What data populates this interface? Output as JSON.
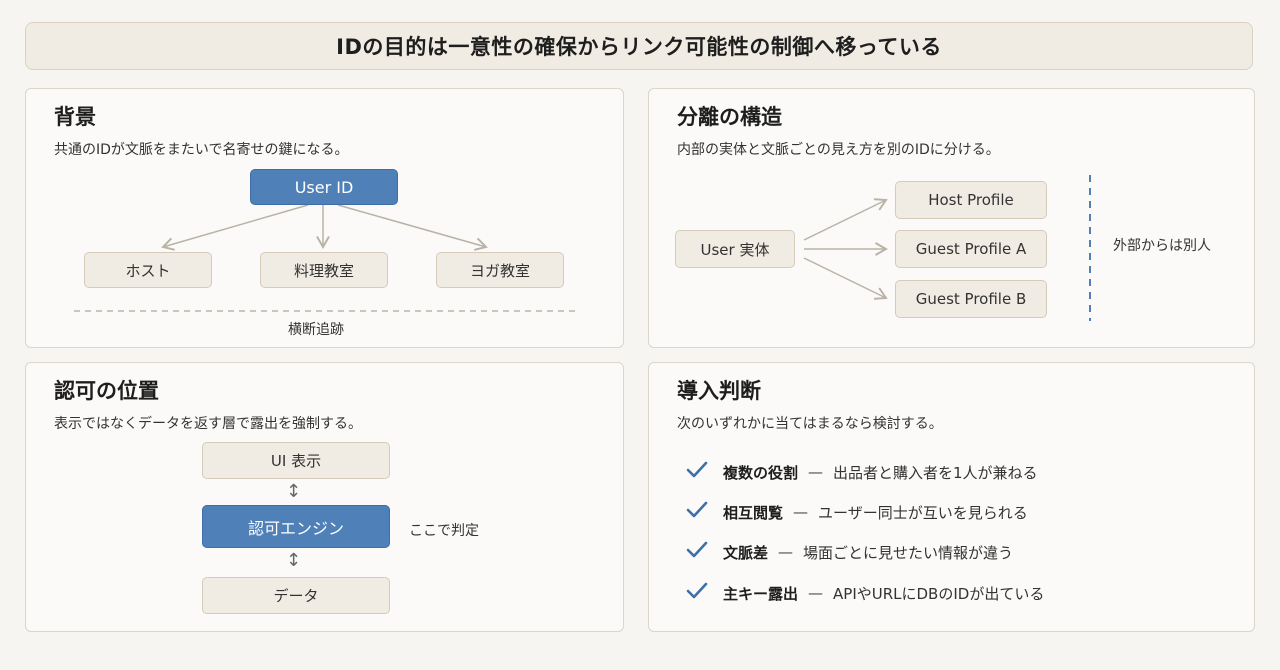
{
  "title": "IDの目的は一意性の確保からリンク可能性の制御へ移っている",
  "panels": {
    "background": {
      "heading": "背景",
      "subtitle": "共通のIDが文脈をまたいで名寄せの鍵になる。",
      "root": "User ID",
      "children": [
        "ホスト",
        "料理教室",
        "ヨガ教室"
      ],
      "footer": "横断追跡"
    },
    "separation": {
      "heading": "分離の構造",
      "subtitle": "内部の実体と文脈ごとの見え方を別のIDに分ける。",
      "source": "User 実体",
      "profiles": [
        "Host Profile",
        "Guest Profile A",
        "Guest Profile B"
      ],
      "side_note": "外部からは別人"
    },
    "authz": {
      "heading": "認可の位置",
      "subtitle": "表示ではなくデータを返す層で露出を強制する。",
      "layers": [
        "UI 表示",
        "認可エンジン",
        "データ"
      ],
      "note": "ここで判定",
      "arrow_glyph": "↕"
    },
    "adoption": {
      "heading": "導入判断",
      "subtitle": "次のいずれかに当てはまるなら検討する。",
      "dash": "—",
      "items": [
        {
          "key": "複数の役割",
          "desc": "出品者と購入者を1人が兼ねる"
        },
        {
          "key": "相互閲覧",
          "desc": "ユーザー同士が互いを見られる"
        },
        {
          "key": "文脈差",
          "desc": "場面ごとに見せたい情報が違う"
        },
        {
          "key": "主キー露出",
          "desc": "APIやURLにDBのIDが出ている"
        }
      ]
    }
  },
  "colors": {
    "accent_blue": "#4f80b7",
    "check_blue": "#3d6fa8",
    "box_fill": "#f1ece3",
    "line_gray": "#b9b2a6"
  },
  "icons": [
    "check-icon",
    "arrow-icon",
    "double-arrow-icon"
  ]
}
